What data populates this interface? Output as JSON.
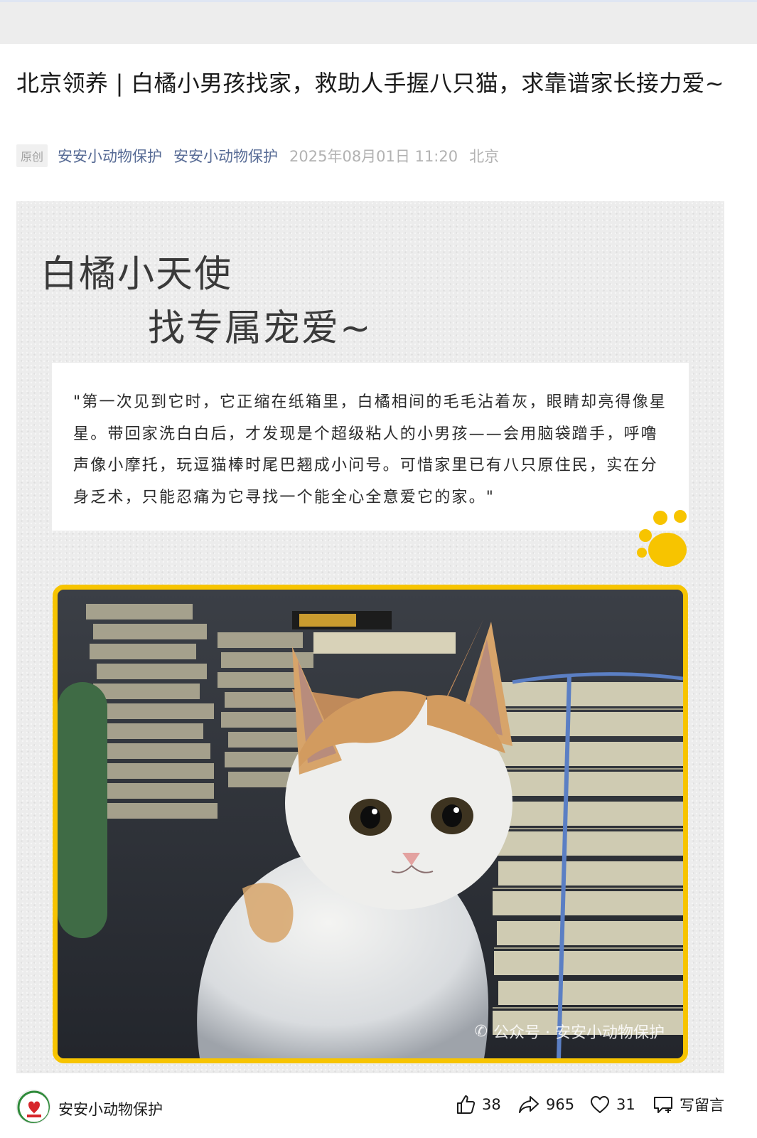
{
  "article": {
    "title": "北京领养 | 白橘小男孩找家，救助人手握八只猫，求靠谱家长接力爱~",
    "badge": "原创",
    "account": "安安小动物保护",
    "author": "安安小动物保护",
    "date": "2025年08月01日 11:20",
    "location": "北京"
  },
  "poster": {
    "heading_line1": "白橘小天使",
    "heading_line2": "找专属宠爱~",
    "quote": "\"第一次见到它时，它正缩在纸箱里，白橘相间的毛毛沾着灰，眼睛却亮得像星星。带回家洗白白后，才发现是个超级粘人的小男孩——会用脑袋蹭手，呼噜声像小摩托，玩逗猫棒时尾巴翘成小问号。可惜家里已有八只原住民，实在分身乏术，只能忍痛为它寻找一个能全心全意爱它的家。\"",
    "watermark": "公众号 · 安安小动物保护"
  },
  "bottom_bar": {
    "account_name": "安安小动物保护",
    "like_count": "38",
    "share_count": "965",
    "favorite_count": "31",
    "comment_label": "写留言"
  },
  "colors": {
    "link": "#576b95",
    "muted": "#b2b2b2",
    "frame": "#f7c400"
  }
}
